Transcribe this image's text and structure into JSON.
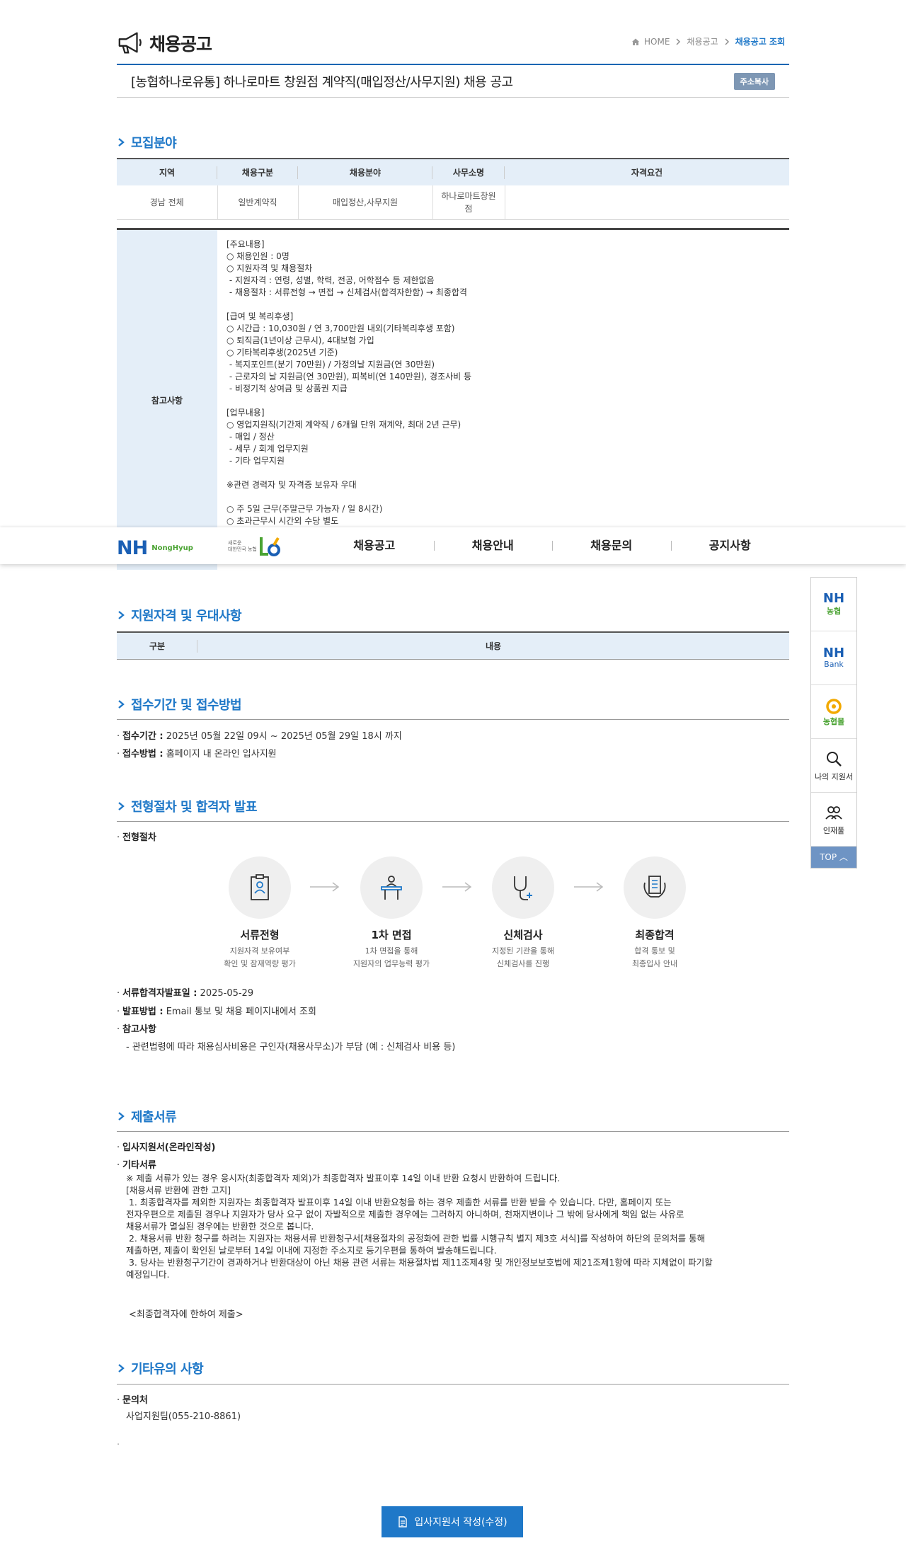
{
  "header": {
    "title": "채용공고",
    "breadcrumb": [
      "HOME",
      "채용공고",
      "채용공고 조회"
    ]
  },
  "posting": {
    "title": "[농협하나로유통] 하나로마트 창원점 계약직(매입정산/사무지원) 채용 공고",
    "copy_label": "주소복사"
  },
  "sections": {
    "recruit": "모집분야",
    "qualify": "지원자격 및 우대사항",
    "period": "접수기간 및 접수방법",
    "process": "전형절차 및 합격자 발표",
    "docs": "제출서류",
    "etc": "기타유의 사항"
  },
  "recruit_table": {
    "headers": [
      "지역",
      "채용구분",
      "채용분야",
      "사무소명",
      "자격요건"
    ],
    "row": [
      "경남 전체",
      "일반계약직",
      "매입정산,사무지원",
      "하나로마트창원\n점",
      ""
    ]
  },
  "reference": {
    "label": "참고사항",
    "body": "[주요내용]\n○ 채용인원 : 0명\n○ 지원자격 및 채용절차\n - 지원자격 : 연령, 성별, 학력, 전공, 어학점수 등 제한없음\n - 채용절차 : 서류전형 → 면접 → 신체검사(합격자한함) → 최종합격\n\n[급여 및 복리후생]\n○ 시간급 : 10,030원 / 연 3,700만원 내외(기타복리후생 포함)\n○ 퇴직금(1년이상 근무시), 4대보험 가입\n○ 기타복리후생(2025년 기준)\n - 복지포인트(분기 70만원) / 가정의날 지원금(연 30만원)\n - 근로자의 날 지원금(연 30만원), 피복비(연 140만원), 경조사비 등\n - 비정기적 상여금 및 상품권 지급\n\n[업무내용]\n○ 영업지원직(기간제 계약직 / 6개월 단위 재계약, 최대 2년 근무)\n - 매입 / 정산\n - 세무 / 회계 업무지원\n - 기타 업무지원\n\n※관련 경력자 및 자격증 보유자 우대\n\n○ 주 5일 근무(주말근무 가능자 / 일 8시간)\n○ 초과근무시 시간외 수당 별도"
  },
  "nav": {
    "logo": "NH",
    "logo_sub": "NongHyup",
    "slogan": "새로운\n대한민국 농협",
    "items": [
      "채용공고",
      "채용안내",
      "채용문의",
      "공지사항"
    ]
  },
  "quick": {
    "items": [
      {
        "big": "NH",
        "sub": "농협"
      },
      {
        "big": "NH",
        "sub": "Bank"
      },
      {
        "sub": "농협몰"
      },
      {
        "label": "나의 지원서"
      },
      {
        "label": "인재풀"
      }
    ],
    "top": "TOP"
  },
  "qualify_table": {
    "headers": [
      "구분",
      "내용"
    ]
  },
  "period": {
    "period_label": "접수기간 :",
    "period_value": "2025년 05월 22일 09시 ~ 2025년 05월 29일 18시 까지",
    "method_label": "접수방법 :",
    "method_value": "홈페이지 내 온라인 입사지원"
  },
  "process": {
    "label": "전형절차",
    "steps": [
      {
        "title": "서류전형",
        "desc": "지원자격 보유여부\n확인 및 잠재역량 평가"
      },
      {
        "title": "1차 면접",
        "desc": "1차 면접을 통해\n지원자의 업무능력 평가"
      },
      {
        "title": "신체검사",
        "desc": "지정된 기관을 통해\n신체검사를 진행"
      },
      {
        "title": "최종합격",
        "desc": "합격 통보 및\n최종입사 안내"
      }
    ],
    "announce_label": "서류합격자발표일 :",
    "announce_value": "2025-05-29",
    "method_label": "발표방법 :",
    "method_value": "Email 통보 및 채용 페이지내에서 조회",
    "note_label": "참고사항",
    "note_value": "- 관련법령에 따라 채용심사비용은 구인자(채용사무소)가 부담 (예 : 신체검사 비용 등)"
  },
  "docs": {
    "item1": "입사지원서(온라인작성)",
    "item2": "기타서류",
    "body": "※ 제출 서류가 있는 경우 응시자(최종합격자 제외)가 최종합격자 발표이후 14일 이내 반환 요청시 반환하여 드립니다.\n[채용서류 반환에 관한 고지]\n 1. 최종합격자를 제외한 지원자는 최종합격자 발표이후 14일 이내 반환요청을 하는 경우 제출한 서류를 반환 받을 수 있습니다. 다만, 홈페이지 또는\n전자우편으로 제출된 경우나 지원자가 당사 요구 없이 자발적으로 제출한 경우에는 그러하지 아니하며, 천재지변이나 그 밖에 당사에게 책임 없는 사유로\n채용서류가 멸실된 경우에는 반환한 것으로 봅니다.\n 2. 채용서류 반환 청구를 하려는 지원자는 채용서류 반환청구서[채용절차의 공정화에 관한 법률 시행규칙 별지 제3호 서식]를 작성하여 하단의 문의처를 통해\n제출하면, 제출이 확인된 날로부터 14일 이내에 지정한 주소지로 등기우편을 통하여 발송해드립니다.\n 3. 당사는 반환청구기간이 경과하거나 반환대상이 아닌 채용 관련 서류는 채용절차법 제11조제4항 및 개인정보보호법에 제21조제1항에 따라 지체없이 파기할\n예정입니다.",
    "note": "<최종합격자에 한하여 제출>"
  },
  "etc": {
    "contact_label": "문의처",
    "contact_value": "사업지원팀(055-210-8861)"
  },
  "apply_button": "입사지원서 작성(수정)",
  "colors": {
    "primary": "#1f78c8",
    "nh_blue": "#1a5fb4",
    "nh_green": "#4aa332",
    "header_bg": "#e4eef8"
  }
}
